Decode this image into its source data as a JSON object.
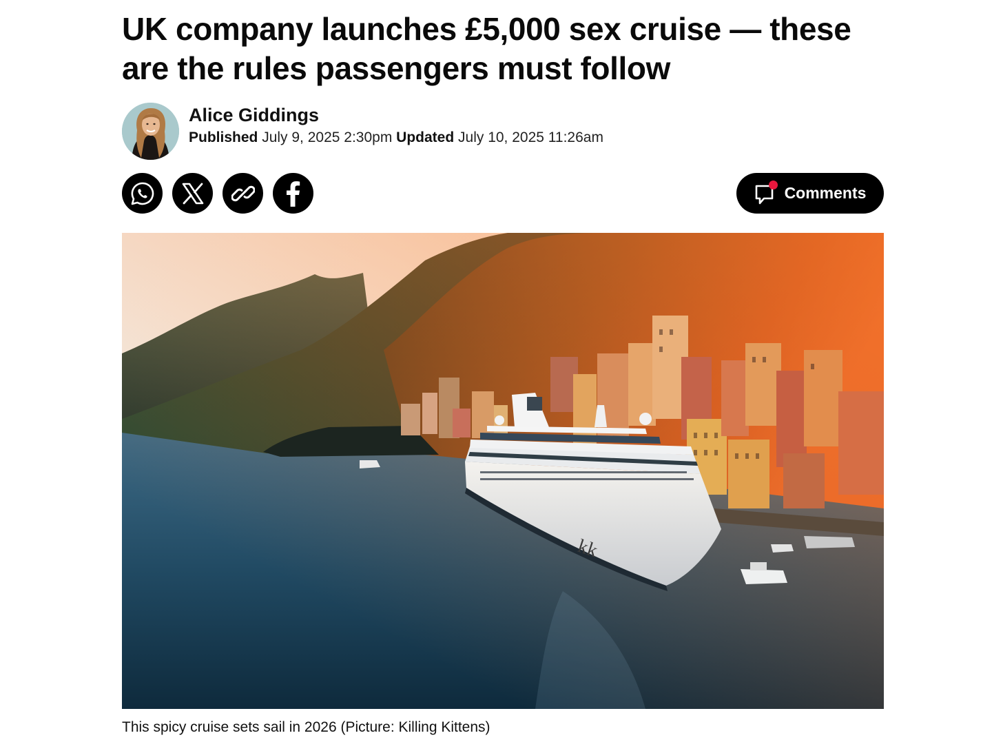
{
  "article": {
    "headline": "UK company launches £5,000 sex cruise — these are the rules passengers must follow",
    "author": "Alice Giddings",
    "published_label": "Published",
    "published_value": "July 9, 2025 2:30pm",
    "updated_label": "Updated",
    "updated_value": "July 10, 2025 11:26am"
  },
  "share": {
    "buttons": [
      {
        "icon": "whatsapp-icon"
      },
      {
        "icon": "x-icon"
      },
      {
        "icon": "link-icon"
      },
      {
        "icon": "facebook-icon"
      }
    ]
  },
  "comments": {
    "label": "Comments",
    "icon": "comment-icon",
    "badge_color": "#e8173d"
  },
  "image": {
    "caption": "This spicy cruise sets sail in 2026 (Picture: Killing Kittens)",
    "ship_logo_text": "kk"
  }
}
